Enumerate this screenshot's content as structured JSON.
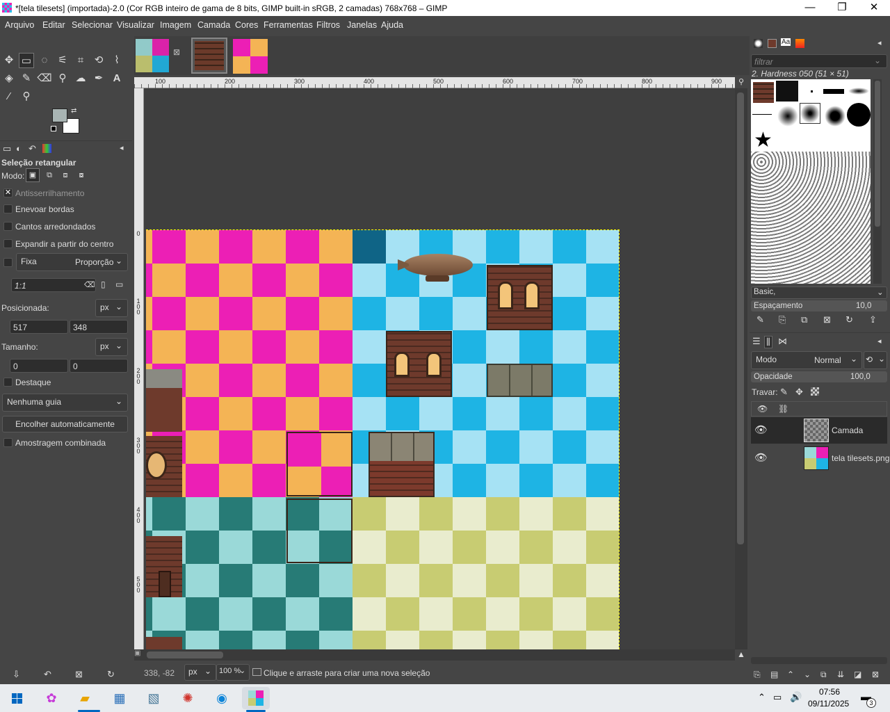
{
  "window": {
    "title": "*[tela tilesets] (importada)-2.0 (Cor RGB inteiro de gama de 8 bits, GIMP built-in sRGB, 2 camadas) 768x768 – GIMP",
    "min": "—",
    "max": "❐",
    "close": "✕"
  },
  "menu": [
    "Arquivo",
    "Editar",
    "Selecionar",
    "Visualizar",
    "Imagem",
    "Camada",
    "Cores",
    "Ferramentas",
    "Filtros",
    "Janelas",
    "Ajuda"
  ],
  "tool_options": {
    "title": "Seleção retangular",
    "mode_label": "Modo:",
    "antialias": "Antisserrilhamento",
    "feather": "Enevoar bordas",
    "rounded": "Cantos arredondados",
    "expand_center": "Expandir a partir do centro",
    "fixed": "Fixa",
    "fixed_mode": "Proporção",
    "ratio": "1:1",
    "position_label": "Posicionada:",
    "position_unit": "px",
    "pos_x": "517",
    "pos_y": "348",
    "size_label": "Tamanho:",
    "size_unit": "px",
    "size_w": "0",
    "size_h": "0",
    "highlight": "Destaque",
    "guides": "Nenhuma guia",
    "autoshrink": "Encolher automaticamente",
    "merged": "Amostragem combinada"
  },
  "ruler_top": [
    "100",
    "200",
    "300",
    "400",
    "500",
    "600",
    "700",
    "800",
    "900"
  ],
  "ruler_left": [
    "0",
    "1 0 0",
    "2 0 0",
    "3 0 0",
    "4 0 0",
    "5 0 0"
  ],
  "status": {
    "coords": "338, -82",
    "unit": "px",
    "zoom": "100 %",
    "message": "Clique e arraste para criar uma nova seleção"
  },
  "brushes": {
    "filter_placeholder": "filtrar",
    "selected": "2. Hardness 050 (51 × 51)",
    "preset": "Basic,",
    "spacing_label": "Espaçamento",
    "spacing_value": "10,0"
  },
  "layers": {
    "mode_label": "Modo",
    "mode_value": "Normal",
    "opacity_label": "Opacidade",
    "opacity_value": "100,0",
    "lock_label": "Travar:",
    "items": [
      {
        "name": "Camada"
      },
      {
        "name": "tela tilesets.png"
      }
    ]
  },
  "taskbar": {
    "time": "07:56",
    "date": "09/11/2025",
    "notif": "3"
  },
  "colors": {
    "magenta": "#ec1fb5",
    "orange": "#f4b455",
    "sky": "#1eb4e4",
    "skylight": "#a6e2f4",
    "teal": "#277b76",
    "tealLight": "#9ad9d8",
    "olive": "#c8cc72",
    "oliveLight": "#e9ecce"
  }
}
